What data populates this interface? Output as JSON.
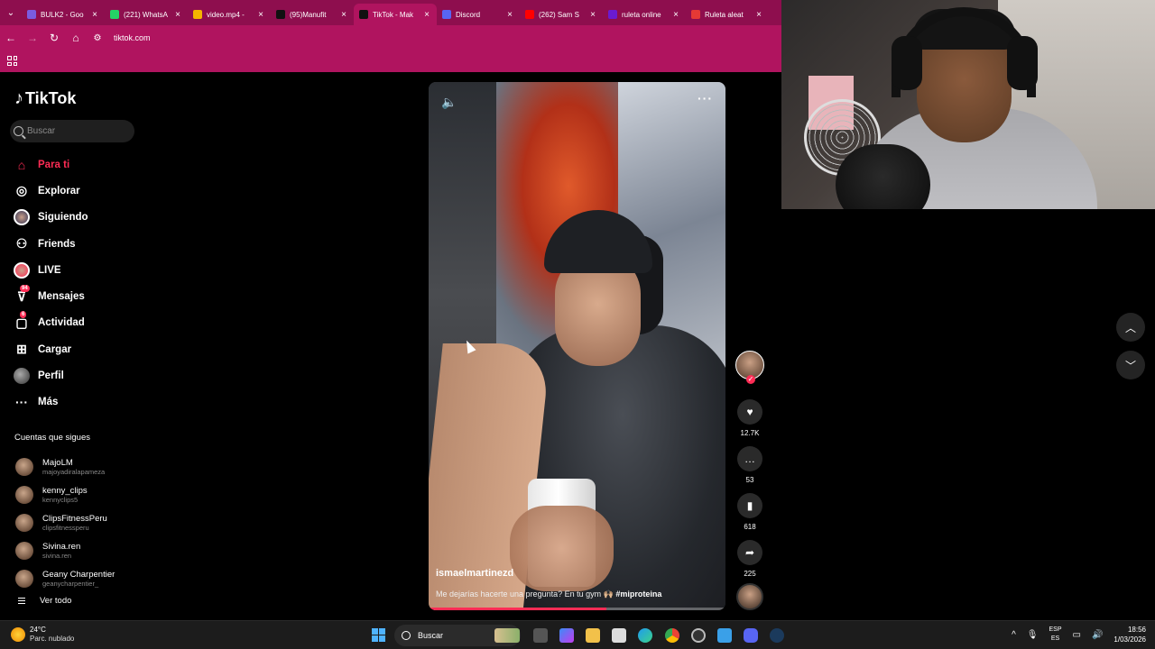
{
  "browser": {
    "tabs": [
      {
        "title": "BULK2 - Goo",
        "color": "#7a5ce0"
      },
      {
        "title": "(221) WhatsA",
        "color": "#25d366"
      },
      {
        "title": "video.mp4 -",
        "color": "#f4b400"
      },
      {
        "title": "(95)Manufit",
        "color": "#111111"
      },
      {
        "title": "TikTok - Mak",
        "color": "#111111"
      },
      {
        "title": "Discord",
        "color": "#5865f2"
      },
      {
        "title": "(262) Sam S",
        "color": "#ff0000"
      },
      {
        "title": "ruleta online",
        "color": "#6a1bd1"
      },
      {
        "title": "Ruleta aleat",
        "color": "#e53935"
      }
    ],
    "active_tab_index": 4,
    "url": "tiktok.com"
  },
  "tiktok": {
    "logo_text": "TikTok",
    "search_placeholder": "Buscar",
    "nav": [
      {
        "label": "Para ti",
        "icon": "home-icon",
        "active": true
      },
      {
        "label": "Explorar",
        "icon": "compass-icon"
      },
      {
        "label": "Siguiendo",
        "icon": "following-avatar-icon"
      },
      {
        "label": "Friends",
        "icon": "friends-icon"
      },
      {
        "label": "LIVE",
        "icon": "live-icon"
      },
      {
        "label": "Mensajes",
        "icon": "messages-icon",
        "badge": "94"
      },
      {
        "label": "Actividad",
        "icon": "activity-icon",
        "badge": "6"
      },
      {
        "label": "Cargar",
        "icon": "upload-icon"
      },
      {
        "label": "Perfil",
        "icon": "profile-icon"
      },
      {
        "label": "Más",
        "icon": "more-icon"
      }
    ],
    "following_title": "Cuentas que sigues",
    "following": [
      {
        "name": "MajoLM",
        "handle": "majoyadiralapameza"
      },
      {
        "name": "kenny_clips",
        "handle": "kennyclips5"
      },
      {
        "name": "ClipsFitnessPeru",
        "handle": "clipsfitnessperu"
      },
      {
        "name": "Sivina.ren",
        "handle": "sivina.ren"
      },
      {
        "name": "Geany Charpentier",
        "handle": "geanycharpentier_"
      }
    ],
    "see_all": "Ver todo",
    "video": {
      "author": "ismaelmartinezd",
      "description": "Me dejarías hacerte una pregunta? En tu gym 🙌🏼",
      "hashtag": "#miproteina",
      "progress": 0.6
    },
    "actions": {
      "likes": "12.7K",
      "comments": "53",
      "saves": "618",
      "shares": "225"
    }
  },
  "taskbar": {
    "weather_temp": "24°C",
    "weather_cond": "Parc. nublado",
    "search_label": "Buscar",
    "lang_top": "ESP",
    "lang_bottom": "ES",
    "time": "18:56",
    "date": "1/03/2026"
  }
}
